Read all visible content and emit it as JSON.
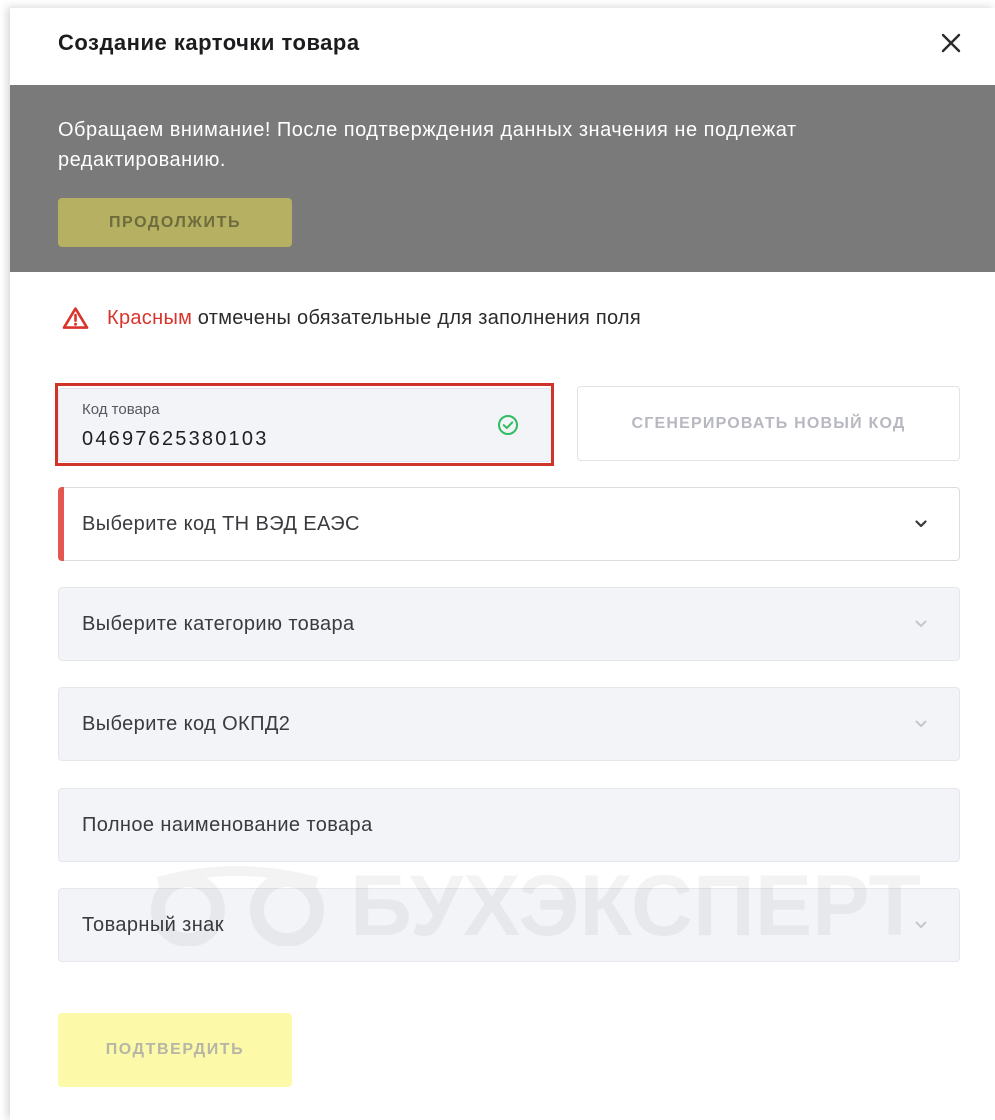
{
  "dialog": {
    "title": "Создание карточки товара",
    "close_icon": "close-icon"
  },
  "notice": {
    "lines": [
      "Обращаем внимание! После подтверждения данных значения не подлежат",
      "редактированию."
    ],
    "continue_label": "ПРОДОЛЖИТЬ"
  },
  "required_hint": {
    "icon": "warning-triangle-icon",
    "highlight": "Красным",
    "rest": "отмечены обязательные для заполнения поля"
  },
  "product_code": {
    "label": "Код товара",
    "value": "04697625380103",
    "valid": true,
    "status_icon": "check-circle-icon",
    "generate_label": "СГЕНЕРИРОВАТЬ НОВЫЙ КОД"
  },
  "fields": [
    {
      "placeholder": "Выберите код ТН ВЭД ЕАЭС",
      "required": true,
      "icon": "chevron-down-icon"
    },
    {
      "placeholder": "Выберите категорию товара",
      "required": false,
      "icon": "chevron-down-icon"
    },
    {
      "placeholder": "Выберите код ОКПД2",
      "required": false,
      "icon": "chevron-down-icon"
    },
    {
      "placeholder": "Полное наименование товара",
      "required": false
    },
    {
      "placeholder": "Товарный знак",
      "required": false,
      "icon": "chevron-down-icon"
    }
  ],
  "confirm_label": "ПОДТВЕРДИТЬ",
  "watermark": {
    "text": "БУХЭКСПЕРТ",
    "logo_icon": "bukhexpert-logo-icon"
  },
  "colors": {
    "overlay": "#7a7a7a",
    "continue_button": "#b5b062",
    "confirm_button": "#fcf9a8",
    "required_red": "#d9342b",
    "valid_green": "#2ebd5f",
    "field_bg": "#f3f4f8",
    "annotation_red": "#cf3429"
  }
}
